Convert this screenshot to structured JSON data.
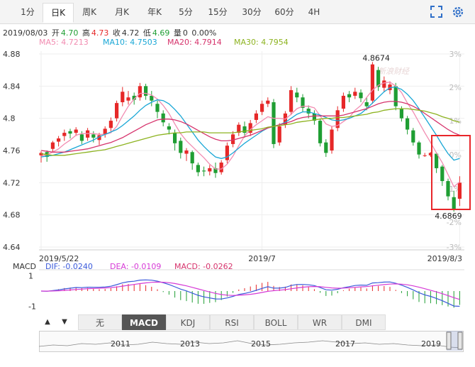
{
  "tabs": [
    {
      "label": "1分",
      "active": false
    },
    {
      "label": "日K",
      "active": true
    },
    {
      "label": "周K",
      "active": false
    },
    {
      "label": "月K",
      "active": false
    },
    {
      "label": "年K",
      "active": false
    },
    {
      "label": "5分",
      "active": false
    },
    {
      "label": "15分",
      "active": false
    },
    {
      "label": "30分",
      "active": false
    },
    {
      "label": "60分",
      "active": false
    },
    {
      "label": "4H",
      "active": false
    }
  ],
  "icons": {
    "fullscreen": "fullscreen-icon",
    "settings": "gear-icon"
  },
  "info": {
    "date": "2019/08/03",
    "open_label": "开",
    "open": "4.70",
    "high_label": "高",
    "high": "4.73",
    "close_label": "收",
    "close": "4.72",
    "low_label": "低",
    "low": "4.69",
    "volume_label": "量",
    "volume": "0",
    "change": "0.00%"
  },
  "ma_legend": [
    {
      "label": "MA5: 4.7213",
      "color": "#f28cb1"
    },
    {
      "label": "MA10: 4.7503",
      "color": "#1aa7d6"
    },
    {
      "label": "MA20: 4.7914",
      "color": "#d6336c"
    },
    {
      "label": "MA30: 4.7954",
      "color": "#8db320"
    }
  ],
  "colors": {
    "up": "#e62828",
    "down": "#1f9e33",
    "grid": "#eeeeee",
    "highlight": "#e8262a"
  },
  "chart_data": [
    {
      "type": "candlestick",
      "y_ticks": [
        "4.88",
        "4.84",
        "4.8",
        "4.76",
        "4.72",
        "4.68",
        "4.64"
      ],
      "ylim": [
        4.64,
        4.88
      ],
      "pct_ticks": [
        "3%",
        "2%",
        "1%",
        "0%",
        "-1%",
        "-2%",
        "-3%"
      ],
      "x_labels": [
        "2019/5/22",
        "2019/7",
        "2019/8/3"
      ],
      "annotations": {
        "max": "4.8674",
        "min": "4.6869"
      },
      "watermark": "新浪财经",
      "candles": [
        [
          4.754,
          4.757,
          4.759,
          4.745
        ],
        [
          4.758,
          4.752,
          4.76,
          4.746
        ],
        [
          4.762,
          4.77,
          4.772,
          4.758
        ],
        [
          4.771,
          4.775,
          4.778,
          4.765
        ],
        [
          4.778,
          4.782,
          4.786,
          4.772
        ],
        [
          4.784,
          4.781,
          4.787,
          4.775
        ],
        [
          4.782,
          4.786,
          4.789,
          4.778
        ],
        [
          4.78,
          4.772,
          4.784,
          4.768
        ],
        [
          4.776,
          4.785,
          4.788,
          4.772
        ],
        [
          4.78,
          4.776,
          4.784,
          4.77
        ],
        [
          4.773,
          4.779,
          4.782,
          4.767
        ],
        [
          4.78,
          4.787,
          4.79,
          4.776
        ],
        [
          4.788,
          4.797,
          4.801,
          4.784
        ],
        [
          4.8,
          4.819,
          4.822,
          4.796
        ],
        [
          4.82,
          4.833,
          4.839,
          4.815
        ],
        [
          4.822,
          4.826,
          4.834,
          4.817
        ],
        [
          4.828,
          4.823,
          4.832,
          4.817
        ],
        [
          4.826,
          4.84,
          4.844,
          4.822
        ],
        [
          4.84,
          4.828,
          4.843,
          4.823
        ],
        [
          4.828,
          4.822,
          4.834,
          4.815
        ],
        [
          4.818,
          4.808,
          4.822,
          4.8
        ],
        [
          4.806,
          4.795,
          4.81,
          4.79
        ],
        [
          4.79,
          4.786,
          4.794,
          4.78
        ],
        [
          4.782,
          4.769,
          4.786,
          4.76
        ],
        [
          4.772,
          4.757,
          4.776,
          4.75
        ],
        [
          4.756,
          4.76,
          4.763,
          4.747
        ],
        [
          4.758,
          4.744,
          4.76,
          4.736
        ],
        [
          4.742,
          4.733,
          4.745,
          4.728
        ],
        [
          4.735,
          4.734,
          4.74,
          4.728
        ],
        [
          4.734,
          4.738,
          4.742,
          4.729
        ],
        [
          4.738,
          4.732,
          4.745,
          4.726
        ],
        [
          4.733,
          4.745,
          4.748,
          4.73
        ],
        [
          4.748,
          4.766,
          4.77,
          4.744
        ],
        [
          4.768,
          4.78,
          4.784,
          4.764
        ],
        [
          4.782,
          4.792,
          4.795,
          4.778
        ],
        [
          4.79,
          4.782,
          4.796,
          4.776
        ],
        [
          4.782,
          4.794,
          4.798,
          4.778
        ],
        [
          4.798,
          4.806,
          4.81,
          4.794
        ],
        [
          4.808,
          4.818,
          4.822,
          4.804
        ],
        [
          4.818,
          4.822,
          4.826,
          4.814
        ],
        [
          4.82,
          4.768,
          4.824,
          4.763
        ],
        [
          4.77,
          4.79,
          4.794,
          4.766
        ],
        [
          4.792,
          4.806,
          4.809,
          4.788
        ],
        [
          4.808,
          4.835,
          4.84,
          4.804
        ],
        [
          4.832,
          4.826,
          4.838,
          4.82
        ],
        [
          4.826,
          4.813,
          4.83,
          4.808
        ],
        [
          4.812,
          4.806,
          4.816,
          4.8
        ],
        [
          4.806,
          4.797,
          4.81,
          4.792
        ],
        [
          4.797,
          4.769,
          4.8,
          4.765
        ],
        [
          4.77,
          4.757,
          4.774,
          4.752
        ],
        [
          4.76,
          4.786,
          4.79,
          4.756
        ],
        [
          4.788,
          4.81,
          4.815,
          4.784
        ],
        [
          4.812,
          4.828,
          4.832,
          4.808
        ],
        [
          4.83,
          4.826,
          4.834,
          4.82
        ],
        [
          4.828,
          4.833,
          4.838,
          4.824
        ],
        [
          4.832,
          4.825,
          4.836,
          4.82
        ],
        [
          4.82,
          4.815,
          4.826,
          4.81
        ],
        [
          4.822,
          4.867,
          4.87,
          4.818
        ],
        [
          4.86,
          4.839,
          4.864,
          4.834
        ],
        [
          4.838,
          4.847,
          4.852,
          4.833
        ],
        [
          4.835,
          4.842,
          4.846,
          4.83
        ],
        [
          4.84,
          4.815,
          4.844,
          4.81
        ],
        [
          4.812,
          4.8,
          4.815,
          4.796
        ],
        [
          4.8,
          4.786,
          4.803,
          4.78
        ],
        [
          4.785,
          4.77,
          4.788,
          4.766
        ],
        [
          4.77,
          4.755,
          4.772,
          4.75
        ],
        [
          4.754,
          4.754,
          4.757,
          4.752
        ],
        [
          4.754,
          4.757,
          4.758,
          4.752
        ],
        [
          4.756,
          4.738,
          4.758,
          4.732
        ],
        [
          4.74,
          4.722,
          4.742,
          4.716
        ],
        [
          4.722,
          4.703,
          4.725,
          4.698
        ],
        [
          4.702,
          4.687,
          4.71,
          4.684
        ],
        [
          4.7,
          4.72,
          4.728,
          4.691
        ]
      ],
      "ma5": [
        4.753,
        4.755,
        4.758,
        4.762,
        4.768,
        4.773,
        4.779,
        4.781,
        4.781,
        4.781,
        4.78,
        4.78,
        4.782,
        4.79,
        4.803,
        4.815,
        4.824,
        4.831,
        4.831,
        4.829,
        4.824,
        4.816,
        4.806,
        4.793,
        4.781,
        4.772,
        4.765,
        4.758,
        4.751,
        4.743,
        4.737,
        4.737,
        4.743,
        4.753,
        4.766,
        4.778,
        4.786,
        4.792,
        4.797,
        4.802,
        4.8,
        4.8,
        4.799,
        4.805,
        4.812,
        4.815,
        4.815,
        4.813,
        4.803,
        4.793,
        4.79,
        4.791,
        4.796,
        4.801,
        4.81,
        4.816,
        4.826,
        4.835,
        4.841,
        4.844,
        4.845,
        4.84,
        4.832,
        4.819,
        4.808,
        4.795,
        4.782,
        4.77,
        4.757,
        4.745,
        4.73,
        4.715,
        4.721
      ],
      "ma10": [
        4.752,
        4.753,
        4.754,
        4.756,
        4.758,
        4.761,
        4.764,
        4.767,
        4.77,
        4.773,
        4.777,
        4.78,
        4.783,
        4.786,
        4.791,
        4.797,
        4.803,
        4.81,
        4.816,
        4.82,
        4.823,
        4.822,
        4.818,
        4.811,
        4.803,
        4.793,
        4.783,
        4.773,
        4.765,
        4.758,
        4.752,
        4.75,
        4.752,
        4.757,
        4.763,
        4.769,
        4.774,
        4.779,
        4.784,
        4.788,
        4.79,
        4.792,
        4.795,
        4.8,
        4.805,
        4.808,
        4.808,
        4.806,
        4.804,
        4.801,
        4.798,
        4.797,
        4.798,
        4.8,
        4.803,
        4.806,
        4.812,
        4.819,
        4.826,
        4.833,
        4.838,
        4.839,
        4.836,
        4.83,
        4.822,
        4.812,
        4.801,
        4.79,
        4.779,
        4.767,
        4.756,
        4.748,
        4.75
      ],
      "ma20": [
        4.76,
        4.759,
        4.758,
        4.758,
        4.758,
        4.759,
        4.76,
        4.761,
        4.762,
        4.764,
        4.766,
        4.768,
        4.77,
        4.773,
        4.776,
        4.78,
        4.784,
        4.788,
        4.792,
        4.795,
        4.798,
        4.799,
        4.799,
        4.798,
        4.796,
        4.793,
        4.789,
        4.785,
        4.781,
        4.777,
        4.774,
        4.772,
        4.772,
        4.773,
        4.775,
        4.777,
        4.779,
        4.782,
        4.785,
        4.788,
        4.79,
        4.792,
        4.794,
        4.796,
        4.799,
        4.801,
        4.802,
        4.803,
        4.803,
        4.803,
        4.803,
        4.803,
        4.804,
        4.806,
        4.808,
        4.81,
        4.812,
        4.815,
        4.818,
        4.82,
        4.821,
        4.821,
        4.82,
        4.818,
        4.815,
        4.811,
        4.806,
        4.801,
        4.796,
        4.791,
        4.786,
        4.782,
        4.779
      ],
      "ma30": [
        4.756,
        4.755,
        4.754,
        4.754,
        4.754,
        4.755,
        4.756,
        4.757,
        4.758,
        4.759,
        4.76,
        4.761,
        4.763,
        4.765,
        4.767,
        4.769,
        4.771,
        4.773,
        4.775,
        4.777,
        4.779,
        4.78,
        4.781,
        4.782,
        4.782,
        4.783,
        4.783,
        4.783,
        4.783,
        4.782,
        4.782,
        4.782,
        4.782,
        4.782,
        4.783,
        4.784,
        4.785,
        4.786,
        4.787,
        4.789,
        4.79,
        4.791,
        4.792,
        4.793,
        4.795,
        4.796,
        4.797,
        4.798,
        4.799,
        4.8,
        4.8,
        4.801,
        4.801,
        4.802,
        4.803,
        4.804,
        4.805,
        4.807,
        4.808,
        4.81,
        4.811,
        4.812,
        4.812,
        4.812,
        4.811,
        4.81,
        4.809,
        4.807,
        4.805,
        4.802,
        4.8,
        4.797,
        4.795
      ]
    },
    {
      "type": "macd",
      "labels": {
        "name": "MACD",
        "dif": "DIF: -0.0240",
        "dea": "DEA: -0.0109",
        "macd": "MACD: -0.0262"
      },
      "colors": {
        "dif": "#3b5bdb",
        "dea": "#d63ad6"
      },
      "y_ticks": [
        "1",
        "-1"
      ],
      "ylim": [
        -1.4,
        1.4
      ]
    },
    {
      "type": "area",
      "title": "navigator",
      "x_labels": [
        "2011",
        "2013",
        "2015",
        "2017",
        "2019"
      ]
    }
  ],
  "indicator_tabs": [
    {
      "label": "无",
      "active": false
    },
    {
      "label": "MACD",
      "active": true
    },
    {
      "label": "KDJ",
      "active": false
    },
    {
      "label": "RSI",
      "active": false
    },
    {
      "label": "BOLL",
      "active": false
    },
    {
      "label": "WR",
      "active": false
    },
    {
      "label": "DMI",
      "active": false
    }
  ],
  "arrows": {
    "up": "▲",
    "down": "▼"
  }
}
